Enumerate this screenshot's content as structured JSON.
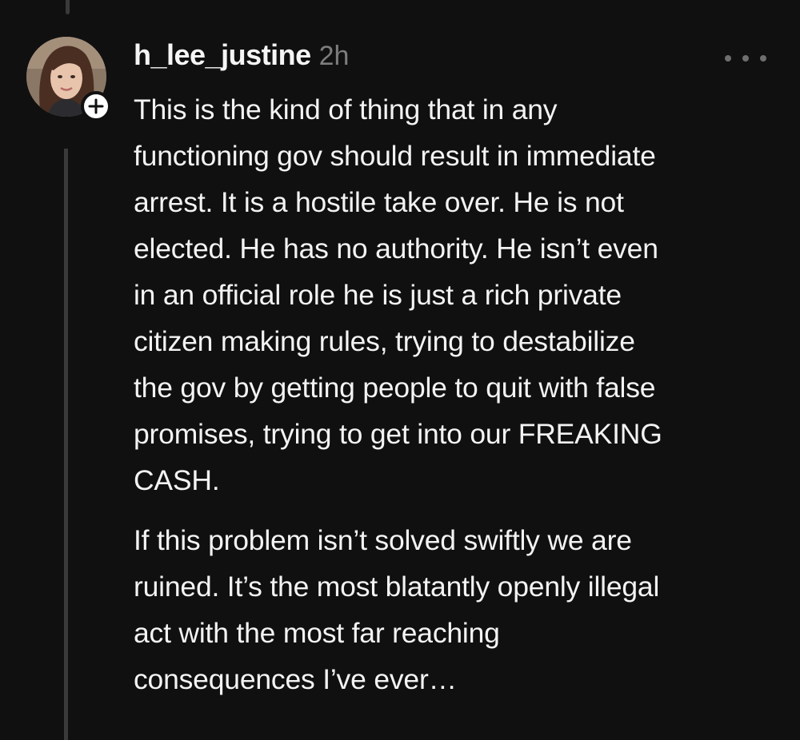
{
  "post": {
    "username": "h_lee_justine",
    "time": "2h",
    "paragraphs": [
      "This is the kind of thing that in any\nfunctioning gov should result in immediate\narrest. It is a hostile take over. He is not\nelected. He has no authority. He isn’t even\nin an official role he is just a rich private\ncitizen making rules, trying to destabilize\nthe gov by getting people to quit with false\npromises, trying to get into our FREAKING\nCASH.",
      "If this problem isn’t solved swiftly we are\nruined. It’s the most blatantly openly illegal\nact with the most far reaching\nconsequences I’ve ever…"
    ]
  },
  "icons": {
    "more": "more-horizontal-icon",
    "follow": "plus-icon"
  },
  "colors": {
    "background": "#101010",
    "text": "#f3f3f3",
    "muted": "#7d7d7d",
    "thread_line": "#3a3a3a"
  }
}
